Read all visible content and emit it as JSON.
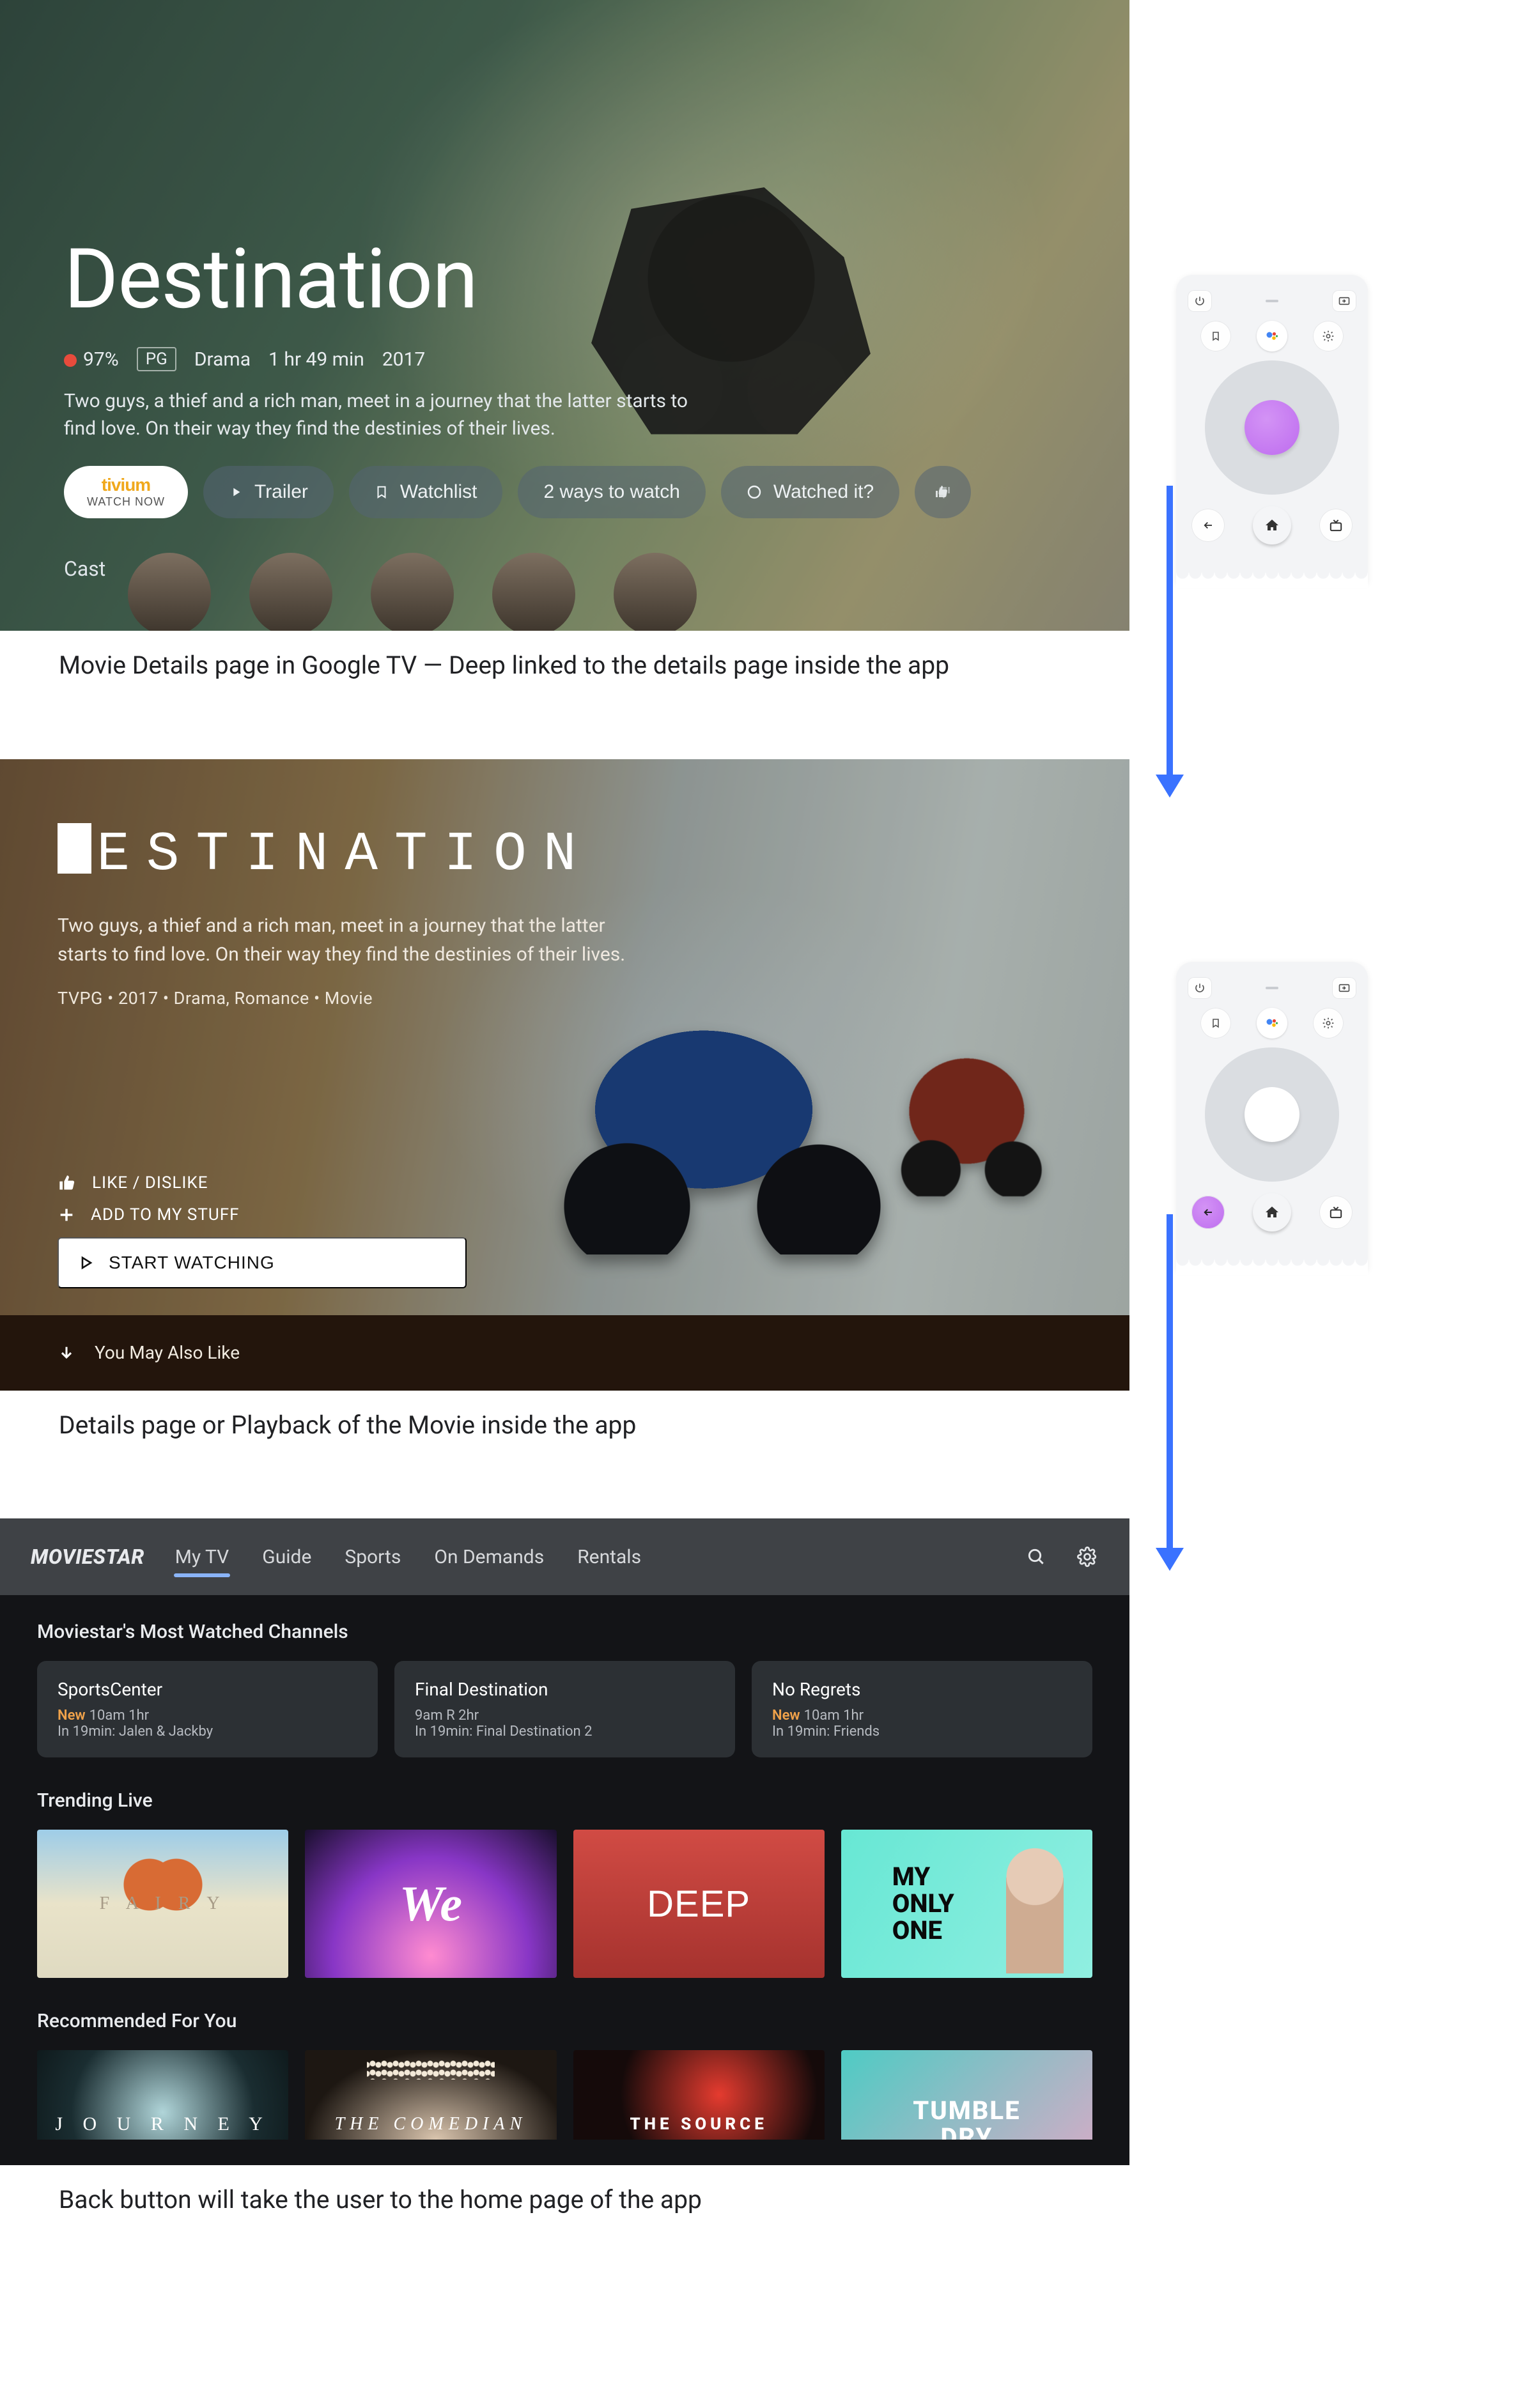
{
  "remote_names": {
    "power": "power",
    "input": "input",
    "bookmark": "bookmark",
    "assistant": "assistant",
    "settings": "settings",
    "back": "back",
    "home": "home",
    "live": "live"
  },
  "panel1": {
    "title": "Destination",
    "score": "97%",
    "rating": "PG",
    "genre": "Drama",
    "runtime": "1 hr 49 min",
    "year": "2017",
    "description": "Two guys, a thief and a rich man, meet in a journey that the latter starts to find love. On their way they find the destinies of their lives.",
    "provider_brand": "tivium",
    "provider_sub": "WATCH NOW",
    "buttons": {
      "trailer": "Trailer",
      "watchlist": "Watchlist",
      "ways": "2 ways to watch",
      "watched": "Watched it?"
    },
    "cast_label": "Cast"
  },
  "caption1": "Movie Details page in Google TV — Deep linked to the details page inside the app",
  "panel2": {
    "title_rest": "ESTINATION",
    "description": "Two guys, a thief and a rich man, meet in a journey that the latter starts to find love. On their way they find the destinies of their lives.",
    "meta": "TVPG • 2017 • Drama, Romance • Movie",
    "like_label": "LIKE / DISLIKE",
    "add_label": "ADD TO MY STUFF",
    "start_label": "START WATCHING",
    "footer_label": "You May Also Like"
  },
  "caption2": "Details page or Playback of the Movie inside the app",
  "panel3": {
    "brand": "MOVIESTAR",
    "tabs": [
      "My TV",
      "Guide",
      "Sports",
      "On Demands",
      "Rentals"
    ],
    "active_tab": 0,
    "section_channels_title": "Moviestar's Most Watched Channels",
    "channels": [
      {
        "title": "SportsCenter",
        "new": true,
        "time": "10am 1hr",
        "next": "In 19min: Jalen & Jackby"
      },
      {
        "title": "Final Destination",
        "new": false,
        "time": "9am R 2hr",
        "next": "In 19min: Final Destination 2"
      },
      {
        "title": "No Regrets",
        "new": true,
        "time": "10am 1hr",
        "next": "In 19min: Friends"
      }
    ],
    "new_badge": "New",
    "section_trending_title": "Trending Live",
    "trending": [
      {
        "label": "F A I R Y"
      },
      {
        "label": "We"
      },
      {
        "label": "DEEP"
      },
      {
        "label": "MY\nONLY\nONE"
      }
    ],
    "section_recommended_title": "Recommended For You",
    "recommended": [
      {
        "label": "J O U R N E Y"
      },
      {
        "label": "THE  COMEDIAN"
      },
      {
        "label": "THE SOURCE"
      },
      {
        "label": "TUMBLE\nDRY"
      }
    ]
  },
  "caption3": "Back button will take the user to the home page of the app"
}
